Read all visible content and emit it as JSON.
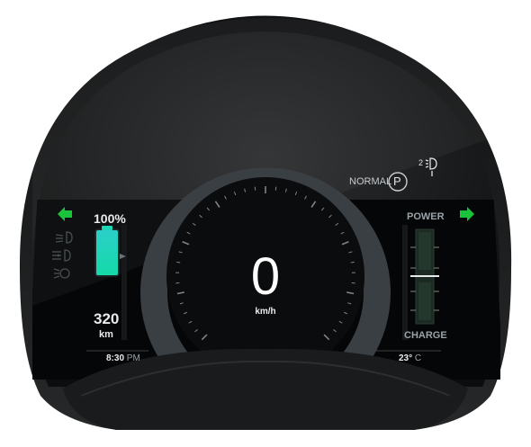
{
  "header": {
    "drive_mode_label": "NORMAL",
    "gear": "P",
    "light_level": "2"
  },
  "battery": {
    "percent_label": "100%",
    "level_fraction": 1.0,
    "range_value": "320",
    "range_unit": "km"
  },
  "speed": {
    "value": "0",
    "unit": "km/h"
  },
  "power_meter": {
    "top_label": "POWER",
    "bottom_label": "CHARGE",
    "level_fraction": 0.0
  },
  "status_bar": {
    "time": "8:30",
    "time_suffix": "PM",
    "temperature": "23°",
    "temperature_unit": "C"
  },
  "indicators": {
    "left_turn_color": "#19c43a",
    "right_turn_color": "#19c43a",
    "battery_color": "#1ad6b8"
  },
  "icons": [
    "left-turn-arrow-icon",
    "right-turn-arrow-icon",
    "low-beam-icon",
    "fog-light-icon",
    "headlight-auto-icon",
    "headlight-level-icon",
    "battery-icon"
  ]
}
